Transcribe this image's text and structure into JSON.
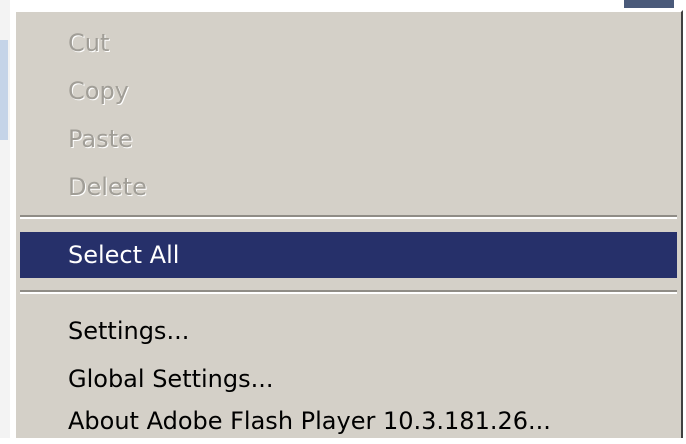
{
  "context_menu": {
    "items": [
      {
        "label": "Cut",
        "enabled": false
      },
      {
        "label": "Copy",
        "enabled": false
      },
      {
        "label": "Paste",
        "enabled": false
      },
      {
        "label": "Delete",
        "enabled": false
      },
      {
        "label": "Select All",
        "enabled": true,
        "selected": true
      },
      {
        "label": "Settings...",
        "enabled": true
      },
      {
        "label": "Global Settings...",
        "enabled": true
      },
      {
        "label": "About Adobe Flash Player 10.3.181.26...",
        "enabled": true
      }
    ]
  },
  "colors": {
    "menu_background": "#d4d0c8",
    "highlight": "#26306a",
    "disabled_text": "#a19e97"
  }
}
